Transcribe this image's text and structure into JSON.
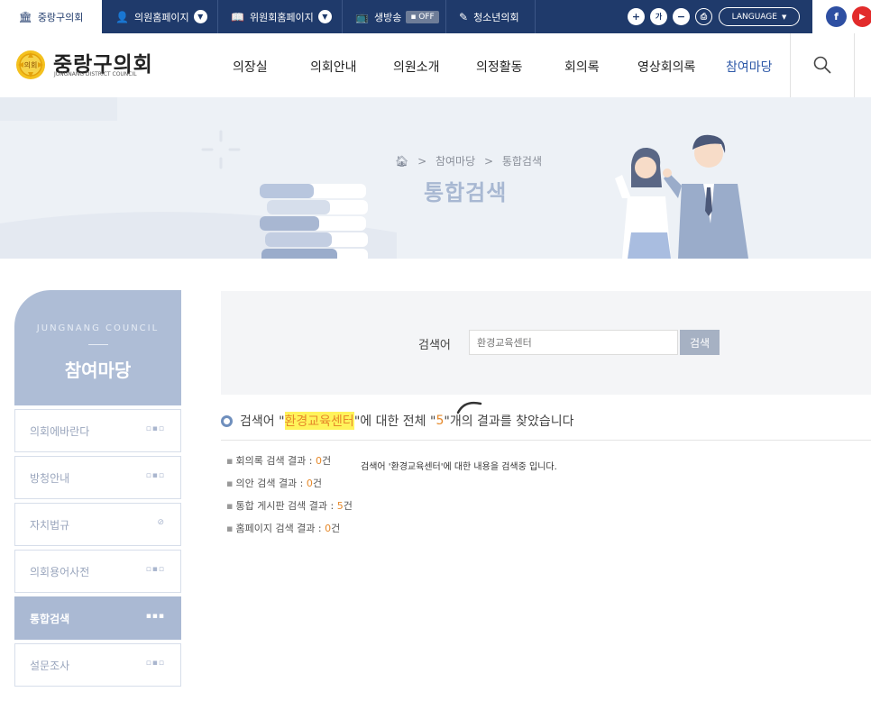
{
  "topbar": {
    "items": [
      {
        "label": "중랑구의회",
        "icon": "building-icon"
      },
      {
        "label": "의원홈페이지",
        "icon": "person-icon"
      },
      {
        "label": "위원회홈페이지",
        "icon": "book-icon"
      },
      {
        "label": "생방송",
        "icon": "tv-icon",
        "badge": "▪ OFF"
      },
      {
        "label": "청소년의회",
        "icon": "pen-icon"
      }
    ],
    "zoom_in": "+",
    "font_label": "가",
    "zoom_out": "−",
    "language": "LANGUAGE",
    "colors": {
      "bar": "#1f3a6b",
      "facebook": "#2e4fa2",
      "youtube": "#e22b2b"
    }
  },
  "logo": {
    "title": "중랑구의회",
    "subtitle": "JUNGNANG DISTRICT COUNCIL",
    "emblem_text": "의회"
  },
  "gnb": [
    "의장실",
    "의회안내",
    "의원소개",
    "의정활동",
    "회의록",
    "영상회의록",
    "참여마당"
  ],
  "banner": {
    "breadcrumb": [
      "참여마당",
      "통합검색"
    ],
    "title": "통합검색"
  },
  "sidebar": {
    "en_title": "JUNGNANG COUNCIL",
    "title": "참여마당",
    "items": [
      {
        "label": "의회에바란다",
        "mark": "▫▪▫"
      },
      {
        "label": "방청안내",
        "mark": "▫▪▫"
      },
      {
        "label": "자치법규",
        "mark": "⊘"
      },
      {
        "label": "의회용어사전",
        "mark": "▫▪▫"
      },
      {
        "label": "통합검색",
        "mark": "▪▪▪"
      },
      {
        "label": "설문조사",
        "mark": "▫▪▫"
      }
    ]
  },
  "search": {
    "label": "검색어",
    "value": "환경교육센터",
    "button": "검색"
  },
  "result": {
    "prefix": "검색어 \"",
    "keyword": "환경교육센터",
    "middle": "\"에 대한 전체 \"",
    "total": "5",
    "suffix": "\"개의 결과를 찾았습니다",
    "loading_message": "검색어 '환경교육센터'에 대한 내용을 검색중 입니다.",
    "stats": [
      {
        "label": "회의록 검색 결과 : ",
        "count": "0",
        "unit": "건"
      },
      {
        "label": "의안 검색 결과 : ",
        "count": "0",
        "unit": "건"
      },
      {
        "label": "통합 게시판 검색 결과 : ",
        "count": "5",
        "unit": "건"
      },
      {
        "label": "홈페이지 검색 결과 : ",
        "count": "0",
        "unit": "건"
      }
    ]
  }
}
